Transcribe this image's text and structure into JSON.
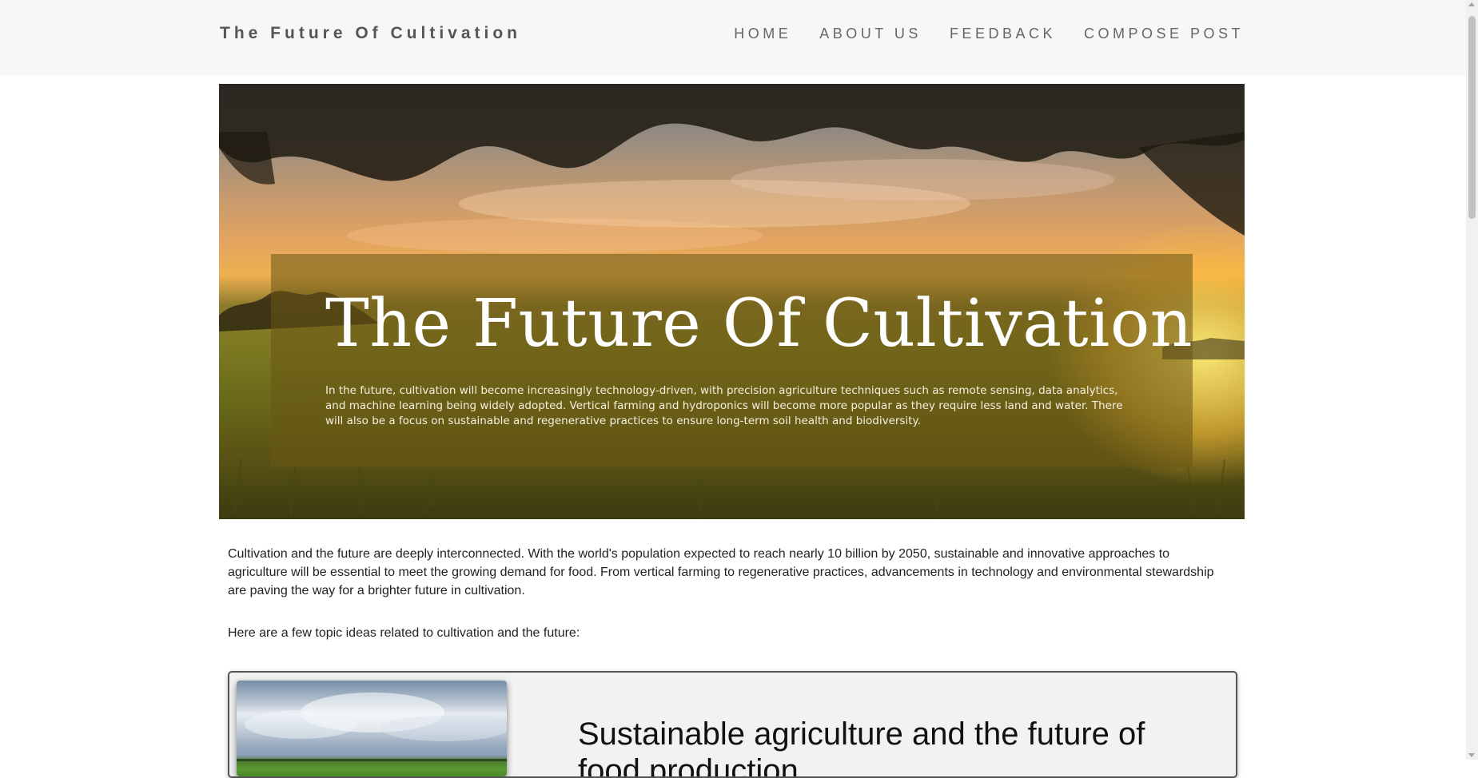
{
  "nav": {
    "brand": "The Future Of Cultivation",
    "links": [
      "HOME",
      "ABOUT US",
      "FEEDBACK",
      "COMPOSE POST"
    ]
  },
  "hero": {
    "title": "The Future Of Cultivation",
    "text": "In the future, cultivation will become increasingly technology-driven, with precision agriculture techniques such as remote sensing, data analytics, and machine learning being widely adopted. Vertical farming and hydroponics will become more popular as they require less land and water. There will also be a focus on sustainable and regenerative practices to ensure long-term soil health and biodiversity."
  },
  "content": {
    "intro": "Cultivation and the future are deeply interconnected. With the world's population expected to reach nearly 10 billion by 2050, sustainable and innovative approaches to agriculture will be essential to meet the growing demand for food. From vertical farming to regenerative practices, advancements in technology and environmental stewardship are paving the way for a brighter future in cultivation.",
    "topic_lead": "Here are a few topic ideas related to cultivation and the future:",
    "cards": [
      {
        "title": "Sustainable agriculture and the future of food production"
      }
    ]
  },
  "colors": {
    "navbar_bg": "#f7f7f7",
    "card_bg": "#f2f2f2",
    "overlay": "rgba(105,85,20,0.55)"
  }
}
